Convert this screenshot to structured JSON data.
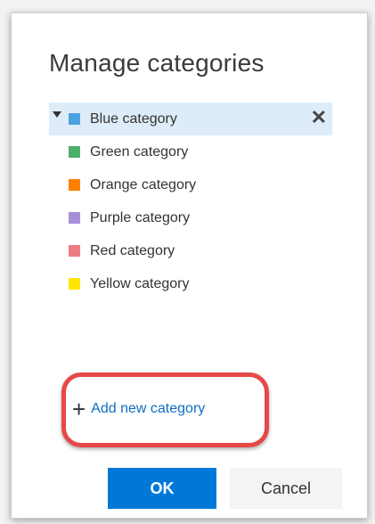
{
  "dialog": {
    "title": "Manage categories"
  },
  "categories": [
    {
      "label": "Blue category",
      "color": "#4aa3df",
      "selected": true
    },
    {
      "label": "Green category",
      "color": "#4caf6a"
    },
    {
      "label": "Orange category",
      "color": "#ff7f00"
    },
    {
      "label": "Purple category",
      "color": "#a88fd8"
    },
    {
      "label": "Red category",
      "color": "#ef7b84"
    },
    {
      "label": "Yellow category",
      "color": "#ffe600"
    }
  ],
  "actions": {
    "delete_icon": "close-icon",
    "add_label": "Add new category",
    "ok_label": "OK",
    "cancel_label": "Cancel"
  }
}
